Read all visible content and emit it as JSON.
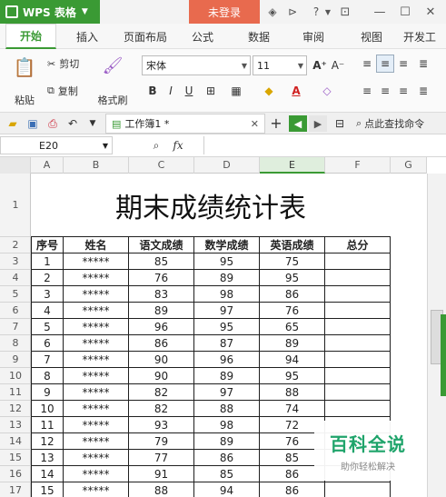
{
  "titlebar": {
    "app_name": "WPS 表格",
    "login_label": "未登录"
  },
  "ribbon_tabs": [
    "开始",
    "插入",
    "页面布局",
    "公式",
    "数据",
    "审阅",
    "视图",
    "开发工"
  ],
  "ribbon": {
    "paste_label": "粘贴",
    "cut_label": "剪切",
    "copy_label": "复制",
    "format_painter_label": "格式刷",
    "font_name": "宋体",
    "font_size": "11"
  },
  "docbar": {
    "doc_tab_label": "工作簿1 *",
    "search_label": "点此查找命令"
  },
  "formula_bar": {
    "cell_ref": "E20",
    "fx_label": "fx"
  },
  "sheet": {
    "column_headers": [
      "A",
      "B",
      "C",
      "D",
      "E",
      "F",
      "G"
    ],
    "row_headers": [
      "1",
      "2",
      "3",
      "4",
      "5",
      "6",
      "7",
      "8",
      "9",
      "10",
      "11",
      "12",
      "13",
      "14",
      "15",
      "16",
      "17"
    ],
    "title": "期末成绩统计表",
    "table_header": [
      "序号",
      "姓名",
      "语文成绩",
      "数学成绩",
      "英语成绩",
      "总分"
    ],
    "rows": [
      [
        "1",
        "*****",
        "85",
        "95",
        "75",
        ""
      ],
      [
        "2",
        "*****",
        "76",
        "89",
        "95",
        ""
      ],
      [
        "3",
        "*****",
        "83",
        "98",
        "86",
        ""
      ],
      [
        "4",
        "*****",
        "89",
        "97",
        "76",
        ""
      ],
      [
        "5",
        "*****",
        "96",
        "95",
        "65",
        ""
      ],
      [
        "6",
        "*****",
        "86",
        "87",
        "89",
        ""
      ],
      [
        "7",
        "*****",
        "90",
        "96",
        "94",
        ""
      ],
      [
        "8",
        "*****",
        "90",
        "89",
        "95",
        ""
      ],
      [
        "9",
        "*****",
        "82",
        "97",
        "88",
        ""
      ],
      [
        "10",
        "*****",
        "82",
        "88",
        "74",
        ""
      ],
      [
        "11",
        "*****",
        "93",
        "98",
        "72",
        ""
      ],
      [
        "12",
        "*****",
        "79",
        "89",
        "76",
        ""
      ],
      [
        "13",
        "*****",
        "77",
        "86",
        "85",
        ""
      ],
      [
        "14",
        "*****",
        "91",
        "85",
        "86",
        ""
      ],
      [
        "15",
        "*****",
        "88",
        "94",
        "86",
        ""
      ]
    ]
  },
  "watermark": {
    "main": "百科全说",
    "sub": "助你轻松解决"
  },
  "colors": {
    "accent_green": "#3a9a34",
    "login_orange": "#e86a4e"
  }
}
